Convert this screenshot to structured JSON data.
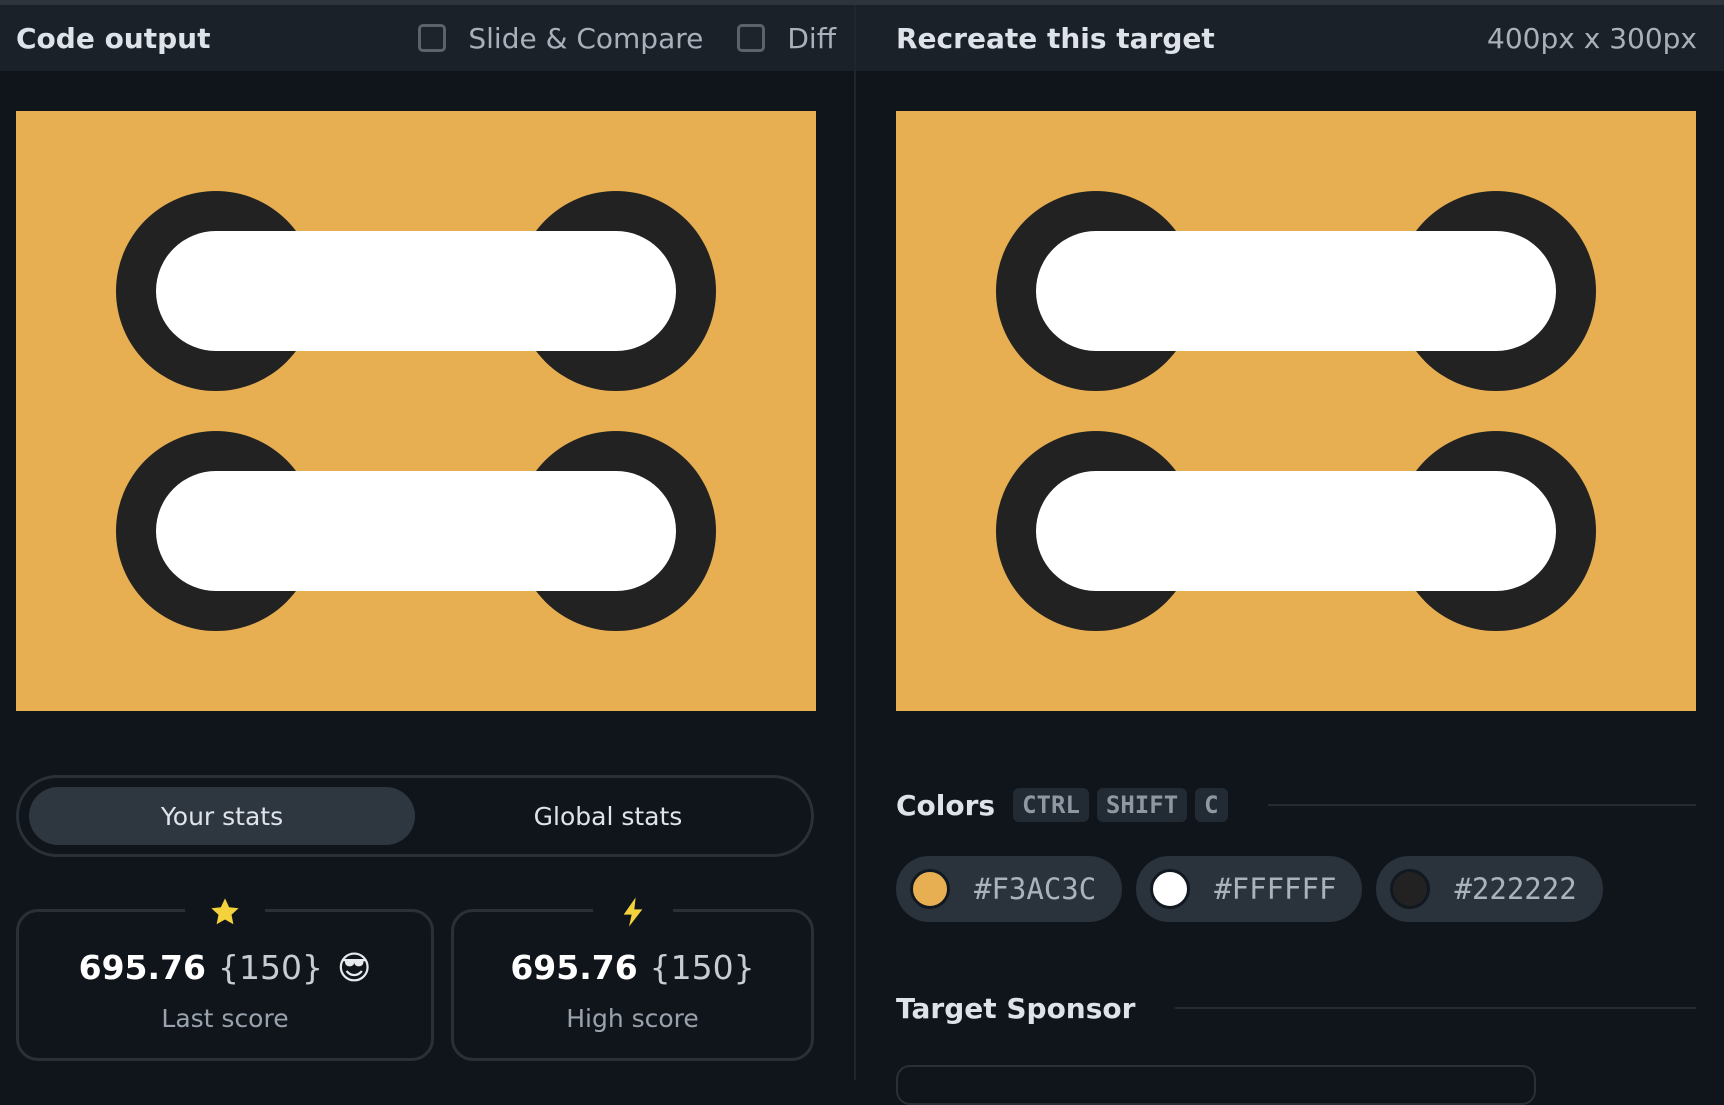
{
  "code_panel": {
    "title": "Code output",
    "slide_compare_label": "Slide & Compare",
    "diff_label": "Diff"
  },
  "target_panel": {
    "title": "Recreate this target",
    "size_label": "400px x 300px"
  },
  "stats_toggle": {
    "your_stats": "Your stats",
    "global_stats": "Global stats"
  },
  "stats": {
    "last": {
      "icon": "star-icon",
      "value": "695.76",
      "count": "{150}",
      "emoji": "😎",
      "label": "Last score"
    },
    "high": {
      "icon": "lightning-icon",
      "value": "695.76",
      "count": "{150}",
      "label": "High score"
    }
  },
  "colors_section": {
    "title": "Colors",
    "shortcut": [
      "CTRL",
      "SHIFT",
      "C"
    ],
    "swatches": [
      {
        "hex": "#F3AC3C"
      },
      {
        "hex": "#FFFFFF"
      },
      {
        "hex": "#222222"
      }
    ]
  },
  "sponsor_section": {
    "title": "Target Sponsor"
  },
  "colors": {
    "canvas_bg": "#e8af52",
    "ring": "#222222",
    "pill": "#ffffff",
    "swatch_orange": "#e8af52",
    "swatch_white": "#ffffff",
    "swatch_dark": "#222222",
    "star": "#f4d23c",
    "bolt": "#f4d23c"
  }
}
